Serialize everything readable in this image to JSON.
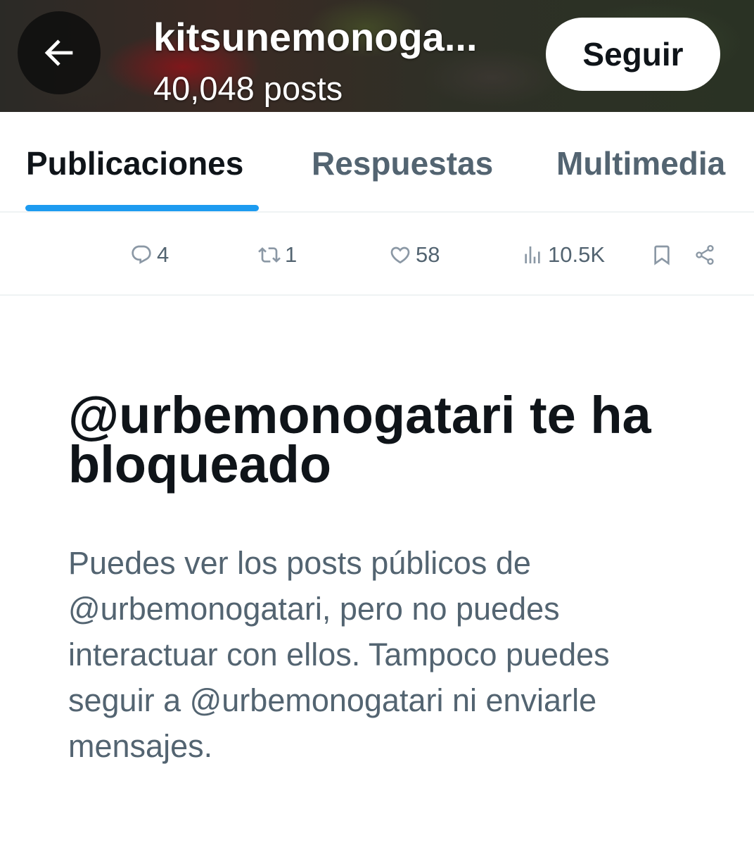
{
  "header": {
    "profile_name": "kitsunemonoga...",
    "post_count": "40,048 posts",
    "follow_label": "Seguir"
  },
  "tabs": [
    {
      "label": "Publicaciones",
      "active": true
    },
    {
      "label": "Respuestas",
      "active": false
    },
    {
      "label": "Multimedia",
      "active": false
    }
  ],
  "post_actions": {
    "replies": "4",
    "reposts": "1",
    "likes": "58",
    "views": "10.5K"
  },
  "blocked_notice": {
    "title": "@urbemonogatari te ha bloqueado",
    "description": "Puedes ver los posts públicos de @urbemonogatari, pero no puedes interactuar con ellos. Tampoco puedes seguir a @urbemonogatari ni enviarle mensajes."
  },
  "colors": {
    "accent": "#1d9bf0",
    "text_primary": "#0f1419",
    "text_secondary": "#536471"
  }
}
